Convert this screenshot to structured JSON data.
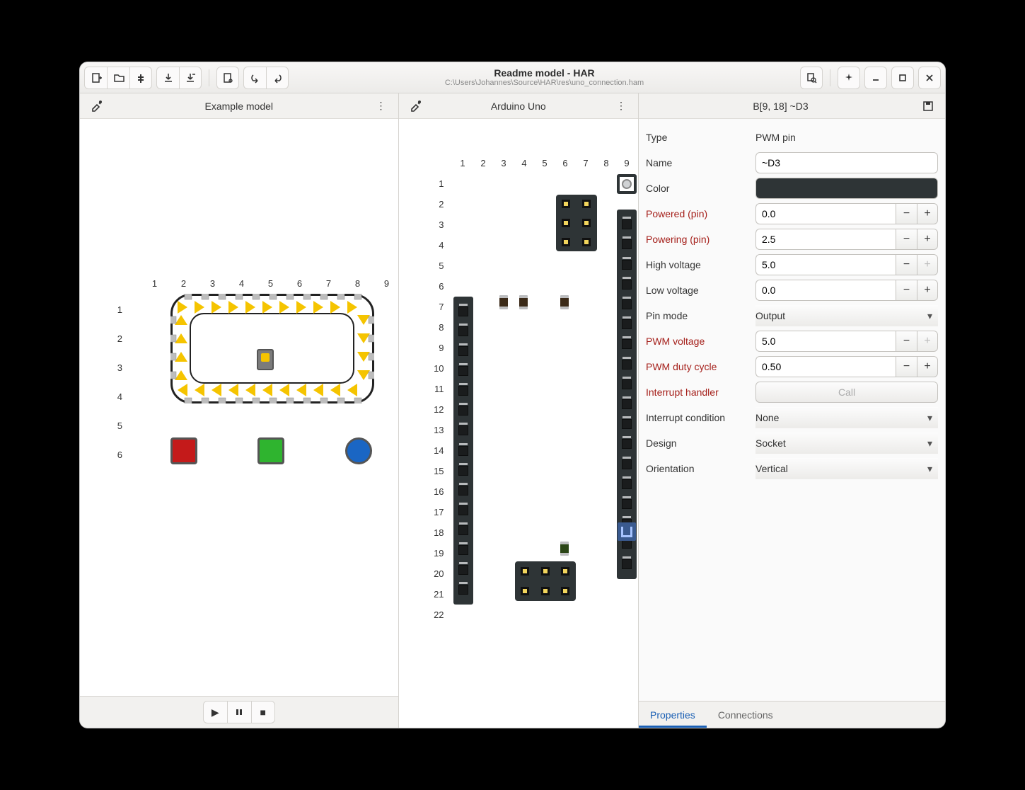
{
  "titlebar": {
    "title": "Readme model - HAR",
    "subtitle": "C:\\Users\\Johannes\\Source\\HAR\\res\\uno_connection.ham"
  },
  "panes": {
    "left": {
      "title": "Example model"
    },
    "mid": {
      "title": "Arduino Uno"
    }
  },
  "grid": {
    "left_cols": [
      "1",
      "2",
      "3",
      "4",
      "5",
      "6",
      "7",
      "8",
      "9"
    ],
    "left_rows": [
      "1",
      "2",
      "3",
      "4",
      "5",
      "6"
    ],
    "mid_cols": [
      "1",
      "2",
      "3",
      "4",
      "5",
      "6",
      "7",
      "8",
      "9"
    ],
    "mid_rows": [
      "1",
      "2",
      "3",
      "4",
      "5",
      "6",
      "7",
      "8",
      "9",
      "10",
      "11",
      "12",
      "13",
      "14",
      "15",
      "16",
      "17",
      "18",
      "19",
      "20",
      "21",
      "22"
    ]
  },
  "selection": {
    "header": "B[9, 18] ~D3"
  },
  "props": {
    "type_label": "Type",
    "type_value": "PWM pin",
    "name_label": "Name",
    "name_value": "~D3",
    "color_label": "Color",
    "color_value": "#2e3436",
    "powered_label": "Powered (pin)",
    "powered_value": "0.0",
    "powering_label": "Powering (pin)",
    "powering_value": "2.5",
    "highv_label": "High voltage",
    "highv_value": "5.0",
    "lowv_label": "Low voltage",
    "lowv_value": "0.0",
    "pinmode_label": "Pin mode",
    "pinmode_value": "Output",
    "pwmv_label": "PWM voltage",
    "pwmv_value": "5.0",
    "pwmd_label": "PWM duty cycle",
    "pwmd_value": "0.50",
    "irqh_label": "Interrupt handler",
    "irqh_value": "Call",
    "irqc_label": "Interrupt condition",
    "irqc_value": "None",
    "design_label": "Design",
    "design_value": "Socket",
    "orient_label": "Orientation",
    "orient_value": "Vertical"
  },
  "tabs": {
    "properties": "Properties",
    "connections": "Connections"
  }
}
